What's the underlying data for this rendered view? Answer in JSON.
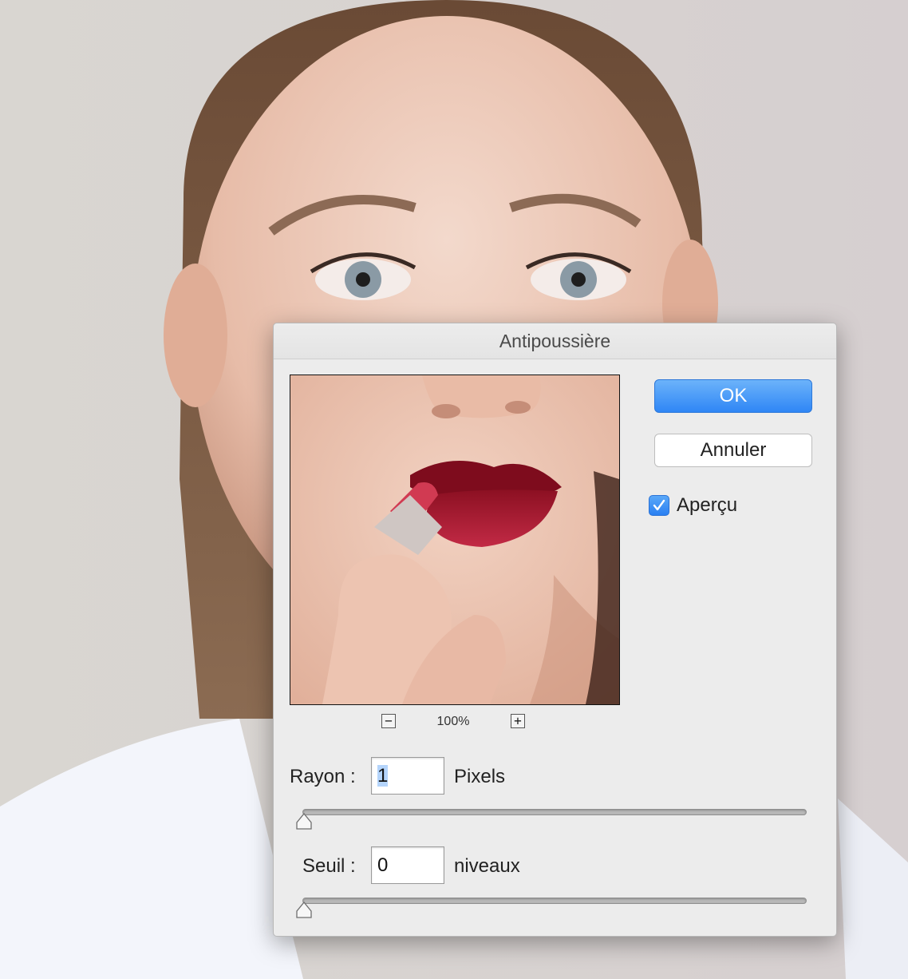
{
  "dialog": {
    "title": "Antipoussière",
    "ok_label": "OK",
    "cancel_label": "Annuler",
    "preview_checkbox": {
      "label": "Aperçu",
      "checked": true
    },
    "zoom": {
      "level": "100%",
      "zoom_out_icon": "minus-icon",
      "zoom_in_icon": "plus-icon"
    },
    "radius": {
      "label": "Rayon :",
      "value": "1",
      "unit": "Pixels",
      "slider_value": 1
    },
    "threshold": {
      "label": "Seuil :",
      "value": "0",
      "unit": "niveaux",
      "slider_value": 0
    }
  },
  "colors": {
    "accent": "#3d8ff7",
    "dialog_bg": "#ececec"
  }
}
